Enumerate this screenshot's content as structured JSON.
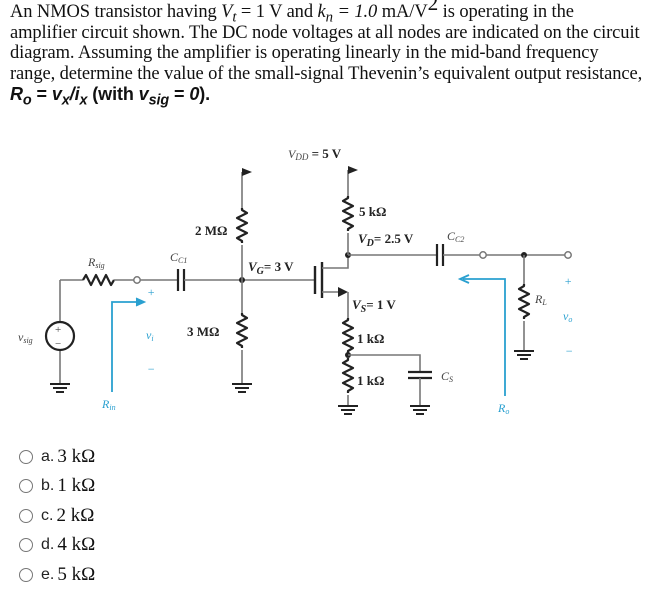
{
  "question": {
    "part1": "An NMOS transistor having ",
    "vt_sym": "V",
    "vt_sub": "t",
    "vt_val": " = 1 V and ",
    "kn_sym": "k",
    "kn_sub": "n",
    "kn_val": " =  1.0 ",
    "kn_unit": "mA/V",
    "kn_exp": "2",
    "part2": "  is operating in the amplifier circuit shown. The DC node voltages at all nodes are indicated on the circuit diagram.  Assuming the amplifier is operating linearly in the mid-band frequency range, determine the value of the small-signal Thevenin’s equivalent output resistance, ",
    "ro_sym": "R",
    "ro_sub": "o",
    "ro_eq": " = ",
    "vx": "v",
    "vx_sub": "x",
    "slash": "/",
    "ix": "i",
    "ix_sub": "x",
    "with_text": " (with ",
    "vsig": "v",
    "vsig_sub": "sig",
    "eq_zero": " = ",
    "zero": "0",
    "close": ")."
  },
  "circuit": {
    "vdd_label": "V",
    "vdd_sub": "DD",
    "vdd_value": " = 5 V",
    "r_top_gate": "2 MΩ",
    "r_bottom_gate": "3 MΩ",
    "vg_sym": "V",
    "vg_sub": "G",
    "vg_value": "= 3 V",
    "rd": "5 kΩ",
    "vd_sym": "V",
    "vd_sub": "D",
    "vd_value": "= 2.5 V",
    "vs_sym": "V",
    "vs_sub": "S",
    "vs_value": "= 1 V",
    "rs1": "1 kΩ",
    "rs2": "1 kΩ",
    "cs_sym": "C",
    "cs_sub": "S",
    "cc1_sym": "C",
    "cc1_sub": "C1",
    "cc2_sym": "C",
    "cc2_sub": "C2",
    "rsig_sym": "R",
    "rsig_sub": "sig",
    "vsig_sym": "v",
    "vsig_sub": "sig",
    "vi_sym": "v",
    "vi_sub": "i",
    "vo_sym": "v",
    "vo_sub": "o",
    "rl_sym": "R",
    "rl_sub": "L",
    "rin_sym": "R",
    "rin_sub": "in",
    "ro_sym": "R",
    "ro_sub": "o",
    "plus": "+",
    "minus": "−",
    "colors": {
      "annotation_blue": "#2aa0d0",
      "wire_gray": "#777777",
      "component_dark": "#222222"
    }
  },
  "options": [
    {
      "letter": "a.",
      "value": "3 kΩ"
    },
    {
      "letter": "b.",
      "value": "1 kΩ"
    },
    {
      "letter": "c.",
      "value": "2 kΩ"
    },
    {
      "letter": "d.",
      "value": "4 kΩ"
    },
    {
      "letter": "e.",
      "value": "5 kΩ"
    }
  ]
}
